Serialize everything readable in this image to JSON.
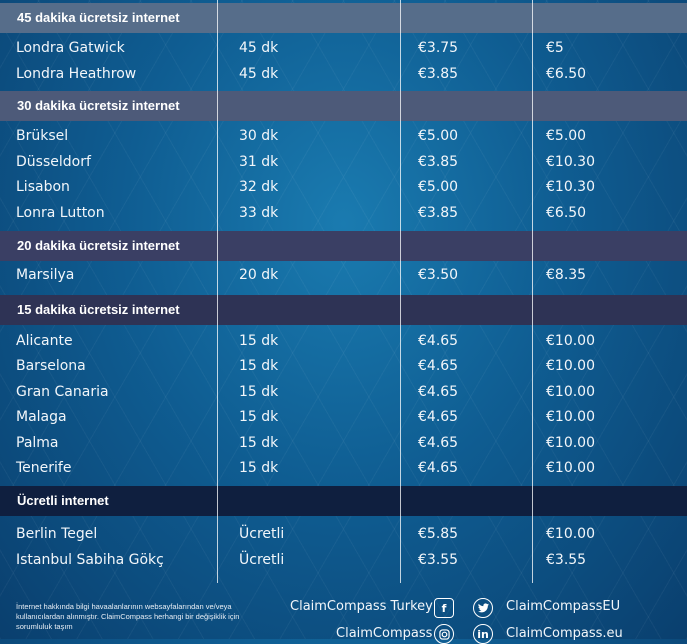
{
  "sections": [
    {
      "title": "45 dakika ücretsiz internet",
      "color": "#566d8a",
      "rows": [
        [
          "Londra Gatwick",
          "45 dk",
          "€3.75",
          "€5"
        ],
        [
          "Londra Heathrow",
          "45 dk",
          "€3.85",
          "€6.50"
        ]
      ]
    },
    {
      "title": "30 dakika ücretsiz internet",
      "color": "#4d5a79",
      "rows": [
        [
          "Brüksel",
          "30 dk",
          "€5.00",
          "€5.00"
        ],
        [
          "Düsseldorf",
          "31 dk",
          "€3.85",
          "€10.30"
        ],
        [
          "Lisabon",
          "32 dk",
          "€5.00",
          "€10.30"
        ],
        [
          "Lonra Lutton",
          "33 dk",
          "€3.85",
          "€6.50"
        ]
      ]
    },
    {
      "title": "20 dakika ücretsiz internet",
      "color": "#3a3f64",
      "rows": [
        [
          "Marsilya",
          "20 dk",
          "€3.50",
          "€8.35"
        ]
      ]
    },
    {
      "title": "15 dakika ücretsiz internet",
      "color": "#2e3355",
      "rows": [
        [
          "Alicante",
          "15 dk",
          "€4.65",
          "€10.00"
        ],
        [
          "Barselona",
          "15 dk",
          "€4.65",
          "€10.00"
        ],
        [
          "Gran Canaria",
          "15 dk",
          "€4.65",
          "€10.00"
        ],
        [
          "Malaga",
          "15 dk",
          "€4.65",
          "€10.00"
        ],
        [
          "Palma",
          "15 dk",
          "€4.65",
          "€10.00"
        ],
        [
          "Tenerife",
          "15 dk",
          "€4.65",
          "€10.00"
        ]
      ]
    },
    {
      "title": "Ücretli internet",
      "color": "#0f1f3f",
      "rows": [
        [
          "Berlin Tegel",
          "Ücretli",
          "€5.85",
          "€10.00"
        ],
        [
          "Istanbul Sabiha Gökç",
          "Ücretli",
          "€3.55",
          "€3.55"
        ]
      ]
    }
  ],
  "footer": {
    "disclaimer": "İnternet hakkında bilgi havaalanlarının websayfalarından ve/veya kullanıcılardan alınmıştır. ClaimCompass herhangi bir değişiklik için sorumluluk taşım",
    "facebook": {
      "label": "ClaimCompass Turkey",
      "icon": "facebook-icon"
    },
    "twitter": {
      "label": "ClaimCompassEU",
      "icon": "twitter-icon"
    },
    "instagram": {
      "label": "ClaimCompass",
      "icon": "instagram-icon"
    },
    "linkedin": {
      "label": "ClaimCompass.eu",
      "icon": "linkedin-icon"
    }
  }
}
